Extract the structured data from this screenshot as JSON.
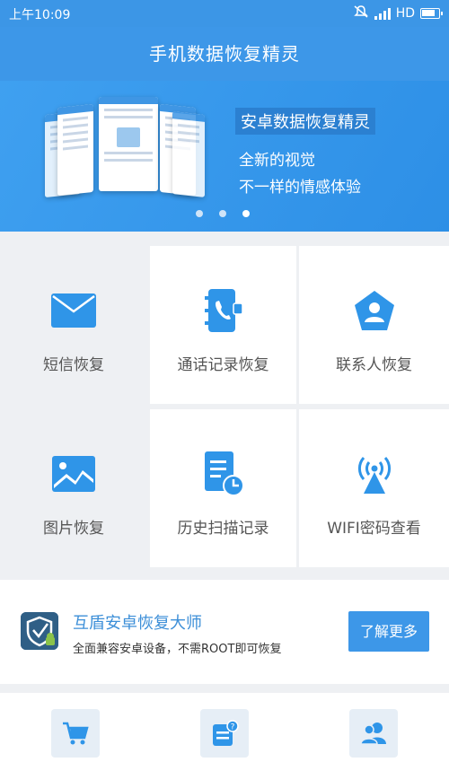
{
  "status_bar": {
    "time": "上午10:09",
    "network": "HD",
    "icons": [
      "mute-icon",
      "signal-icon",
      "battery-icon"
    ]
  },
  "app": {
    "title": "手机数据恢复精灵"
  },
  "banner": {
    "headline": "安卓数据恢复精灵",
    "line1": "全新的视觉",
    "line2": "不一样的情感体验",
    "page_count": 3,
    "active_page": 3
  },
  "features": [
    {
      "label": "短信恢复",
      "icon": "envelope-icon"
    },
    {
      "label": "通话记录恢复",
      "icon": "call-log-icon"
    },
    {
      "label": "联系人恢复",
      "icon": "contact-icon"
    },
    {
      "label": "图片恢复",
      "icon": "image-icon"
    },
    {
      "label": "历史扫描记录",
      "icon": "history-icon"
    },
    {
      "label": "WIFI密码查看",
      "icon": "wifi-tower-icon"
    }
  ],
  "promo": {
    "title": "互盾安卓恢复大师",
    "description": "全面兼容安卓设备，不需ROOT即可恢复",
    "button": "了解更多"
  },
  "bottom_icons": [
    "cart-icon",
    "help-icon",
    "users-icon"
  ],
  "colors": {
    "primary": "#3d97e8",
    "icon_blue": "#2f95e8",
    "background": "#eef0f3"
  }
}
